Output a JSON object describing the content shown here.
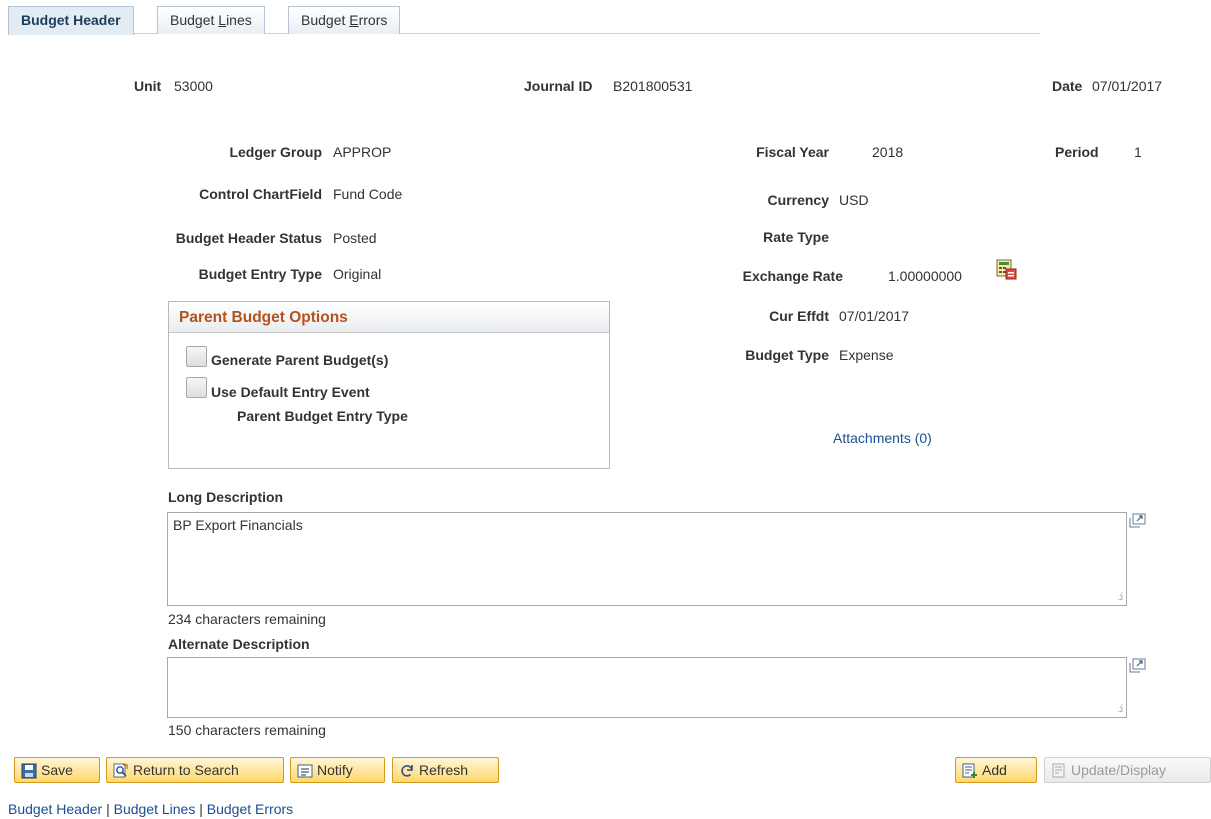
{
  "tabs": [
    {
      "label_pre": "Budget Header",
      "label_u": "",
      "label_post": ""
    },
    {
      "label_pre": "Budget ",
      "label_u": "L",
      "label_post": "ines"
    },
    {
      "label_pre": "Budget ",
      "label_u": "E",
      "label_post": "rrors"
    }
  ],
  "header": {
    "unit_label": "Unit",
    "unit_value": "53000",
    "journal_label": "Journal ID",
    "journal_value": "B201800531",
    "date_label": "Date",
    "date_value": "07/01/2017"
  },
  "left_fields": {
    "ledger_group_label": "Ledger Group",
    "ledger_group_value": "APPROP",
    "control_cf_label": "Control ChartField",
    "control_cf_value": "Fund Code",
    "status_label": "Budget Header Status",
    "status_value": "Posted",
    "entry_type_label": "Budget Entry Type",
    "entry_type_value": "Original"
  },
  "right_fields": {
    "fiscal_year_label": "Fiscal Year",
    "fiscal_year_value": "2018",
    "period_label": "Period",
    "period_value": "1",
    "currency_label": "Currency",
    "currency_value": "USD",
    "rate_type_label": "Rate Type",
    "exchange_rate_label": "Exchange Rate",
    "exchange_rate_value": "1.00000000",
    "cur_effdt_label": "Cur Effdt",
    "cur_effdt_value": "07/01/2017",
    "budget_type_label": "Budget Type",
    "budget_type_value": "Expense",
    "attachments_link": "Attachments (0)"
  },
  "parent_options": {
    "title": "Parent Budget Options",
    "generate_label": "Generate Parent Budget(s)",
    "generate_checked": false,
    "default_event_label": "Use Default Entry Event",
    "default_event_checked": false,
    "entry_type_label": "Parent Budget Entry Type"
  },
  "long_description": {
    "label": "Long Description",
    "value": "BP Export Financials",
    "remaining": "234 characters remaining"
  },
  "alternate_description": {
    "label": "Alternate Description",
    "value": "",
    "remaining": "150 characters remaining"
  },
  "toolbar": {
    "save": "Save",
    "return_to_search": "Return to Search",
    "notify": "Notify",
    "refresh": "Refresh",
    "add": "Add",
    "update_display": "Update/Display"
  },
  "footer_links": {
    "header": "Budget Header",
    "lines": "Budget Lines",
    "errors": "Budget Errors",
    "separator": "|"
  },
  "icons": {
    "exchange_rate": "calculator-icon",
    "expand": "expand-window-icon",
    "save": "save-icon",
    "return_to_search": "return-search-icon",
    "notify": "notify-icon",
    "refresh": "refresh-icon",
    "add": "add-icon",
    "update_display": "update-display-icon"
  },
  "colors": {
    "accent": "#b5521c",
    "link": "#1b4f93",
    "button_fill": "#ffd76b",
    "button_border": "#d49a1e"
  }
}
